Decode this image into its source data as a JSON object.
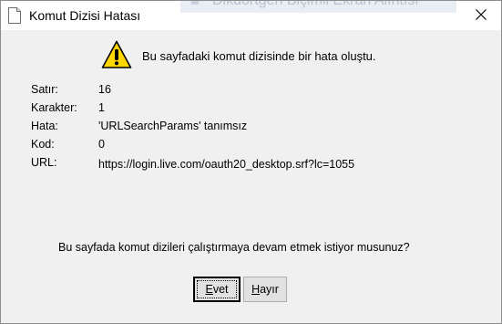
{
  "window": {
    "title": "Komut Dizisi Hatası",
    "background_window_text": "Dikdörtgen Biçimli Ekran Alıntısı"
  },
  "message": {
    "header": "Bu sayfadaki komut dizisinde bir hata oluştu.",
    "details": [
      {
        "label": "Satır:",
        "value": "16"
      },
      {
        "label": "Karakter:",
        "value": "1"
      },
      {
        "label": "Hata:",
        "value": "'URLSearchParams' tanımsız"
      },
      {
        "label": "Kod:",
        "value": "0"
      },
      {
        "label": "URL:",
        "value": "https://login.live.com/oauth20_desktop.srf?lc=1055"
      }
    ],
    "question": "Bu sayfada komut dizileri çalıştırmaya devam etmek istiyor musunuz?"
  },
  "buttons": {
    "yes": {
      "mnemonic": "E",
      "rest": "vet"
    },
    "no": {
      "mnemonic": "H",
      "rest": "ayır"
    }
  },
  "icons": {
    "title": "document-icon",
    "warning": "warning-icon",
    "close": "close-icon"
  },
  "colors": {
    "dialog_bg": "#f0f0f0",
    "titlebar_bg": "#ffffff",
    "warning_yellow": "#ffd800"
  }
}
